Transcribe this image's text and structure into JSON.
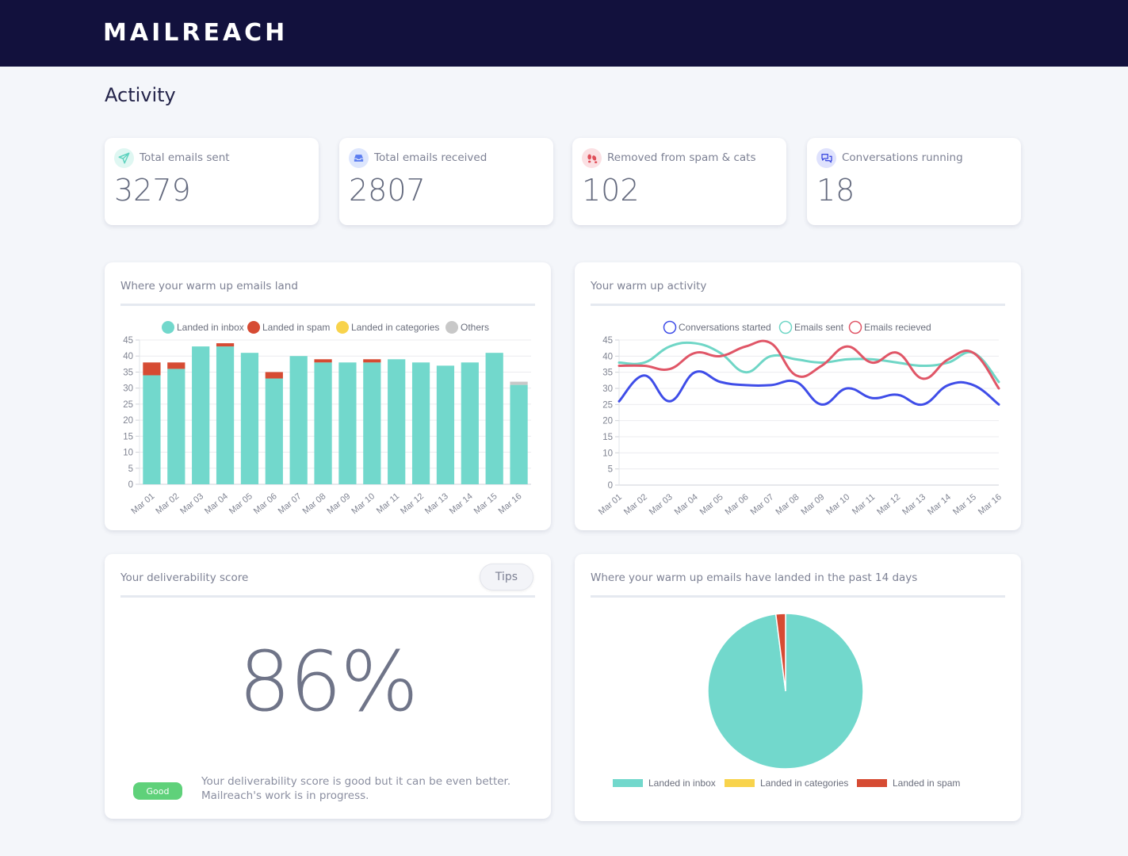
{
  "header": {
    "logo": "MAILREACH"
  },
  "page": {
    "title": "Activity"
  },
  "stats": [
    {
      "label": "Total emails sent",
      "value": "3279",
      "icon": "paper-plane-icon",
      "icon_color": "#5fd3bf",
      "icon_bg": "#dff7f2"
    },
    {
      "label": "Total emails received",
      "value": "2807",
      "icon": "inbox-icon",
      "icon_color": "#5b7df0",
      "icon_bg": "#dde6fd"
    },
    {
      "label": "Removed from spam & cats",
      "value": "102",
      "icon": "footprints-icon",
      "icon_color": "#e0505a",
      "icon_bg": "#fbe0e3"
    },
    {
      "label": "Conversations running",
      "value": "18",
      "icon": "chat-bubbles-icon",
      "icon_color": "#3f4de0",
      "icon_bg": "#dfe2fd"
    }
  ],
  "panels": {
    "land": {
      "title": "Where your warm up emails land"
    },
    "activity": {
      "title": "Your warm up activity"
    },
    "score": {
      "title": "Your deliverability score",
      "tips_label": "Tips",
      "value": "86%",
      "badge": "Good",
      "description": "Your deliverability score is good but it can be even better. Mailreach's work is in progress."
    },
    "pie": {
      "title": "Where your warm up emails have landed in the past 14 days"
    }
  },
  "colors": {
    "inbox": "#72d8cc",
    "spam": "#d64b33",
    "categories": "#f8d34c",
    "others": "#c8c8c8",
    "conversations": "#3f4de8",
    "sent": "#6fd6c6",
    "received": "#e05667"
  },
  "chart_data": [
    {
      "type": "bar",
      "stacked": true,
      "title": "Where your warm up emails land",
      "categories": [
        "Mar 01",
        "Mar 02",
        "Mar 03",
        "Mar 04",
        "Mar 05",
        "Mar 06",
        "Mar 07",
        "Mar 08",
        "Mar 09",
        "Mar 10",
        "Mar 11",
        "Mar 12",
        "Mar 13",
        "Mar 14",
        "Mar 15",
        "Mar 16"
      ],
      "series": [
        {
          "name": "Landed in inbox",
          "color_key": "inbox",
          "values": [
            34,
            36,
            43,
            43,
            41,
            33,
            40,
            38,
            38,
            38,
            39,
            38,
            37,
            38,
            41,
            31
          ]
        },
        {
          "name": "Landed in spam",
          "color_key": "spam",
          "values": [
            4,
            2,
            0,
            1,
            0,
            2,
            0,
            1,
            0,
            1,
            0,
            0,
            0,
            0,
            0,
            0
          ]
        },
        {
          "name": "Landed in categories",
          "color_key": "categories",
          "values": [
            0,
            0,
            0,
            0,
            0,
            0,
            0,
            0,
            0,
            0,
            0,
            0,
            0,
            0,
            0,
            0
          ]
        },
        {
          "name": "Others",
          "color_key": "others",
          "values": [
            0,
            0,
            0,
            0,
            0,
            0,
            0,
            0,
            0,
            0,
            0,
            0,
            0,
            0,
            0,
            1
          ]
        }
      ],
      "yticks": [
        0,
        5,
        10,
        15,
        20,
        25,
        30,
        35,
        40,
        45
      ],
      "ylim": [
        0,
        45
      ],
      "grid": true,
      "legend": "top"
    },
    {
      "type": "line",
      "smooth": true,
      "title": "Your warm up activity",
      "categories": [
        "Mar 01",
        "Mar 02",
        "Mar 03",
        "Mar 04",
        "Mar 05",
        "Mar 06",
        "Mar 07",
        "Mar 08",
        "Mar 09",
        "Mar 10",
        "Mar 11",
        "Mar 12",
        "Mar 13",
        "Mar 14",
        "Mar 15",
        "Mar 16"
      ],
      "series": [
        {
          "name": "Conversations started",
          "color_key": "conversations",
          "values": [
            26,
            34,
            26,
            35,
            32,
            31,
            31,
            32,
            25,
            30,
            27,
            28,
            25,
            31,
            31,
            25
          ]
        },
        {
          "name": "Emails sent",
          "color_key": "sent",
          "values": [
            38,
            38,
            43,
            44,
            41,
            35,
            40,
            39,
            38,
            39,
            39,
            38,
            37,
            38,
            41,
            32
          ]
        },
        {
          "name": "Emails recieved",
          "color_key": "received",
          "values": [
            37,
            37,
            36,
            41,
            40,
            43,
            44,
            34,
            37,
            43,
            38,
            41,
            33,
            39,
            41,
            30
          ]
        }
      ],
      "yticks": [
        0,
        5,
        10,
        15,
        20,
        25,
        30,
        35,
        40,
        45
      ],
      "ylim": [
        0,
        45
      ],
      "grid": true,
      "legend": "top"
    },
    {
      "type": "pie",
      "title": "Where your warm up emails have landed in the past 14 days",
      "slices": [
        {
          "name": "Landed in inbox",
          "color_key": "inbox",
          "value": 98
        },
        {
          "name": "Landed in categories",
          "color_key": "categories",
          "value": 0
        },
        {
          "name": "Landed in spam",
          "color_key": "spam",
          "value": 2
        }
      ],
      "legend": "bottom"
    }
  ]
}
